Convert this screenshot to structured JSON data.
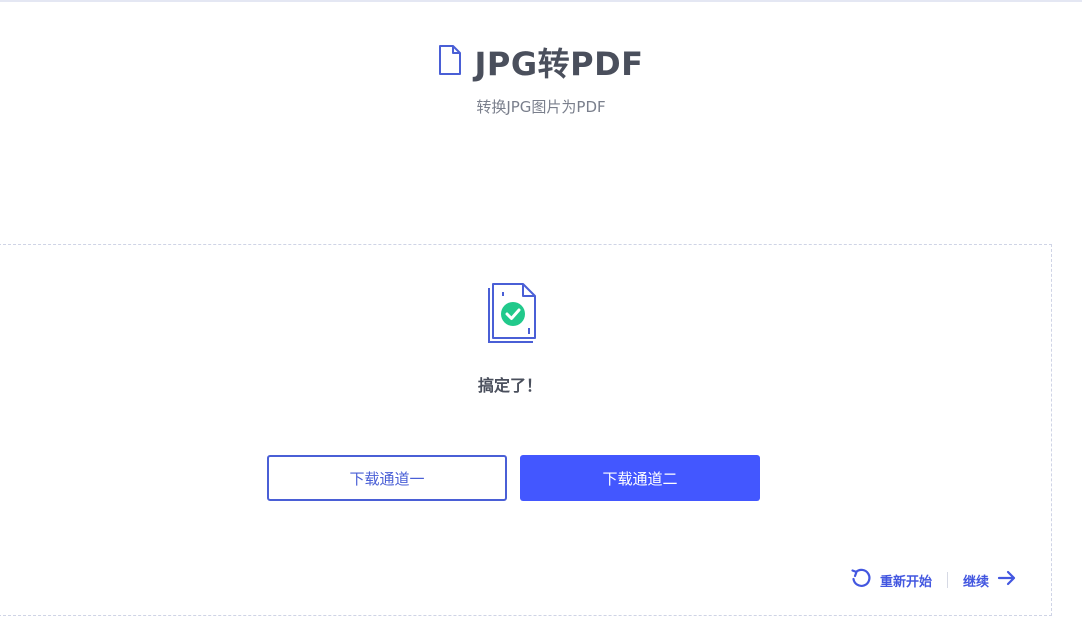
{
  "header": {
    "title": "JPG转PDF",
    "subtitle": "转换JPG图片为PDF"
  },
  "result": {
    "message": "搞定了！"
  },
  "buttons": {
    "download_one": "下载通道一",
    "download_two": "下载通道二"
  },
  "actions": {
    "restart": "重新开始",
    "continue": "继续"
  },
  "colors": {
    "accent": "#4357ff",
    "success": "#21c98b",
    "text": "#4a4f5c"
  }
}
